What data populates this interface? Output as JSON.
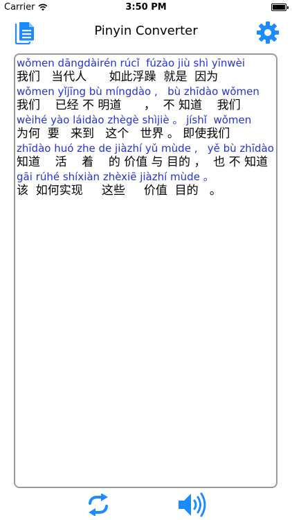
{
  "status_bar": {
    "carrier": "Carrier",
    "time": "3:50 PM",
    "battery_level": 1.0
  },
  "nav": {
    "title": "Pinyin Converter",
    "left_icon": "document-icon",
    "right_icon": "gear-icon"
  },
  "accent_color": "#1a8cff",
  "pinyin_color": "#2433d8",
  "lines": [
    {
      "pinyin": "wǒmen dāngdàirén rúcǐ  fúzào jiù shì yīnwèi",
      "hanzi": "我们   当代人      如此浮躁  就是  因为"
    },
    {
      "pinyin": "wǒmen yǐjīng bù míngdào ,   bù zhīdào wǒmen",
      "hanzi": "我们    已经 不 明道      ，  不 知道    我们"
    },
    {
      "pinyin": "wèihé yào láidào zhègè shìjiè 。 jíshǐ  wǒmen",
      "hanzi": "为何  要   来到   这个   世界 。 即使我们"
    },
    {
      "pinyin": "zhīdào huó zhe de jiàzhí yǔ mùde ,   yě bù zhīdào",
      "hanzi": "知道    活    着    的 价值 与 目的 ，  也 不 知道"
    },
    {
      "pinyin": "gāi rúhé shíxiàn zhèxiē jiàzhí mùde 。",
      "hanzi": "该  如何实现     这些     价值  目的   。"
    }
  ],
  "toolbar": {
    "refresh_icon": "refresh-icon",
    "speaker_icon": "speaker-icon"
  }
}
